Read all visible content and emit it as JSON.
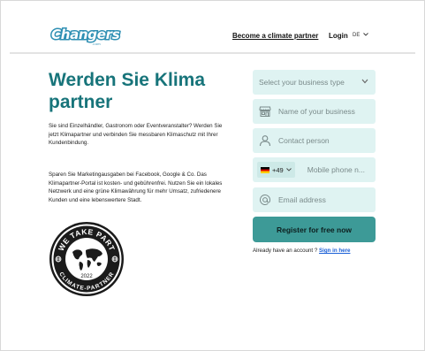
{
  "header": {
    "logo_text": "Changers",
    "logo_sub": ".com",
    "partner_link": "Become a climate partner",
    "login_link": "Login",
    "language": "DE"
  },
  "hero": {
    "headline": "Werden Sie Klima partner",
    "paragraph_1": "Sie sind Einzelhändler, Gastronom oder Eventveranstalter? Werden Sie jetzt Klimapartner und verbinden Sie messbaren Klimaschutz mit Ihrer Kundenbindung.",
    "paragraph_2": "Sparen Sie Marketingausgaben bei Facebook, Google & Co. Das Klimapartner-Portal ist kosten- und gebührenfrei. Nutzen Sie ein lokales Netzwerk und eine grüne Klimawährung für mehr Umsatz, zufriedenere Kunden und eine lebenswertere Stadt."
  },
  "badge": {
    "top_text": "WE TAKE PART",
    "bottom_text": "CLIMATE-PARTNER",
    "year": "2022"
  },
  "form": {
    "business_type_placeholder": "Select your business type",
    "business_name_placeholder": "Name of your business",
    "contact_placeholder": "Contact person",
    "phone_code": "+49",
    "phone_placeholder": "Mobile phone n...",
    "email_placeholder": "Email address",
    "submit_label": "Register for free now",
    "account_text": "Already have an account ?",
    "signin_link": "Sign in here"
  },
  "icons": {
    "business": "storefront-icon",
    "contact": "person-icon",
    "email": "at-sign-icon",
    "flag": "germany-flag-icon"
  },
  "colors": {
    "accent": "#17747a",
    "field_bg": "#dff3f2",
    "button_bg": "#3d9a97",
    "logo": "#2e8fb3",
    "link": "#1a5fd6"
  }
}
